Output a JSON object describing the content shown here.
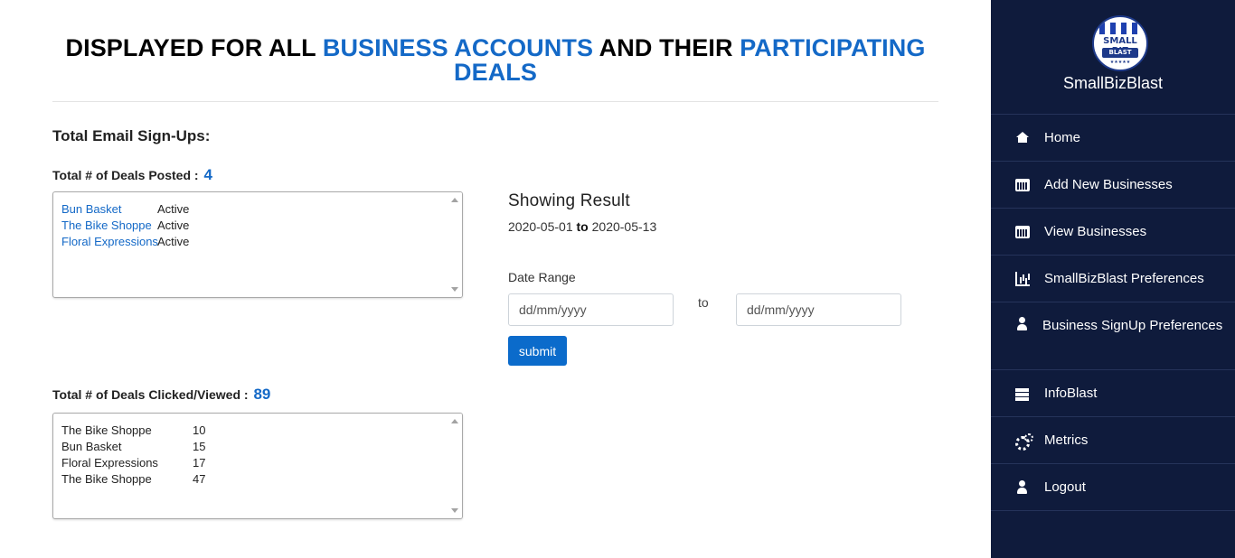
{
  "header": {
    "title_part1": "DISPLAYED FOR ALL ",
    "title_highlight1": "BUSINESS ACCOUNTS",
    "title_part2": " AND THEIR ",
    "title_highlight2": "PARTICIPATING DEALS"
  },
  "main": {
    "email_signups_heading": "Total Email Sign-Ups:",
    "deals_posted_label": "Total # of Deals Posted :",
    "deals_posted_count": "4",
    "deals_posted": [
      {
        "name": "Bun Basket",
        "status": "Active"
      },
      {
        "name": "The Bike Shoppe",
        "status": "Active"
      },
      {
        "name": "Floral Expressions",
        "status": "Active"
      }
    ],
    "deals_clicked_label": "Total # of Deals Clicked/Viewed :",
    "deals_clicked_count": "89",
    "deals_clicked": [
      {
        "name": "The Bike Shoppe",
        "count": "10"
      },
      {
        "name": "Bun Basket",
        "count": "15"
      },
      {
        "name": "Floral Expressions",
        "count": "17"
      },
      {
        "name": "The Bike Shoppe",
        "count": "47"
      }
    ]
  },
  "results": {
    "title": "Showing Result",
    "start_date": "2020-05-01",
    "to_word": "to",
    "end_date": "2020-05-13",
    "date_range_label": "Date Range",
    "from_placeholder": "dd/mm/yyyy",
    "between_label": "to",
    "to_placeholder": "dd/mm/yyyy",
    "submit_label": "submit"
  },
  "sidebar": {
    "logo_line1": "SMALL BIZ",
    "logo_line2": "BLAST",
    "logo_stars": "★★★★★",
    "brand": "SmallBizBlast",
    "items": [
      {
        "label": "Home",
        "icon": "home-icon"
      },
      {
        "label": "Add New Businesses",
        "icon": "calendar-icon"
      },
      {
        "label": "View Businesses",
        "icon": "calendar-icon"
      },
      {
        "label": "SmallBizBlast Preferences",
        "icon": "bar-chart-icon"
      },
      {
        "label": "Business SignUp Preferences",
        "icon": "user-icon"
      },
      {
        "label": "InfoBlast",
        "icon": "server-icon"
      },
      {
        "label": "Metrics",
        "icon": "cogs-icon"
      },
      {
        "label": "Logout",
        "icon": "user-icon"
      }
    ]
  },
  "colors": {
    "accent": "#1469c7",
    "sidebar_bg": "#0f1b3c",
    "button_bg": "#0b6bcb"
  }
}
